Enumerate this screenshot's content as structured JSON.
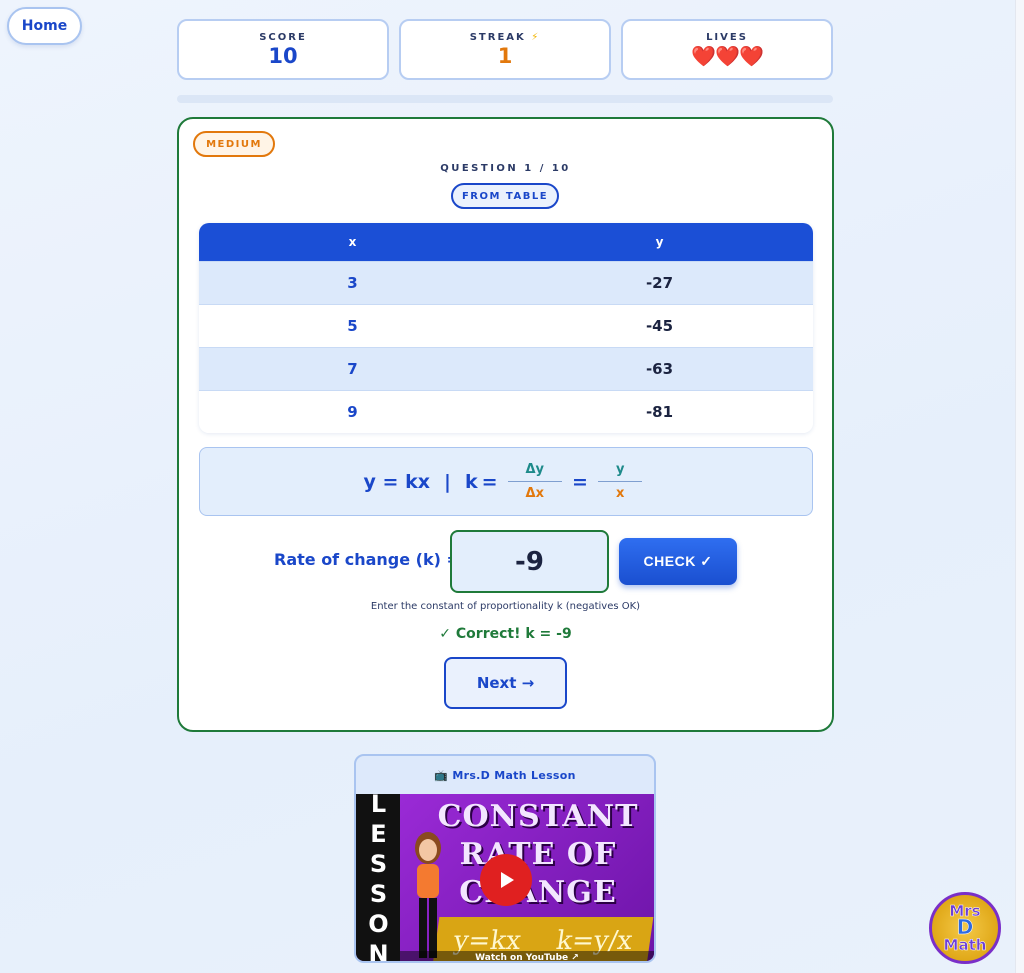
{
  "nav": {
    "home_label": "Home"
  },
  "stats": {
    "score": {
      "label": "SCORE",
      "value": "10"
    },
    "streak": {
      "label": "STREAK",
      "icon": "lightning-icon",
      "value": "1"
    },
    "lives": {
      "label": "LIVES",
      "hearts": "❤️❤️❤️",
      "count": 3
    }
  },
  "progress": {
    "fraction": 0.0
  },
  "colors": {
    "primary": "#1a47c9",
    "success": "#1f7a3a",
    "difficulty": "#e2780c",
    "table_header": "#1b4fd6"
  },
  "question": {
    "difficulty": "MEDIUM",
    "counter": "QUESTION 1 / 10",
    "type": "FROM TABLE",
    "table": {
      "headers": [
        "x",
        "y"
      ],
      "rows": [
        {
          "x": "3",
          "y": "-27"
        },
        {
          "x": "5",
          "y": "-45"
        },
        {
          "x": "7",
          "y": "-63"
        },
        {
          "x": "9",
          "y": "-81"
        }
      ]
    },
    "formula": {
      "lhs": "y = kx",
      "divider": "|",
      "k": "k",
      "eq": "=",
      "frac1_num": "Δy",
      "frac1_den": "Δx",
      "frac2_num": "y",
      "frac2_den": "x"
    },
    "answer_label": "Rate of change (k) =",
    "answer_value": "-9",
    "check_label": "CHECK ✓",
    "hint": "Enter the constant of proportionality k (negatives OK)",
    "feedback": "✓ Correct! k = -9",
    "next_label": "Next →"
  },
  "lesson": {
    "title": "📺 Mrs.D Math Lesson",
    "side_text": "LESSON",
    "video_title_line1": "CONSTANT",
    "video_title_line2": "RATE OF",
    "video_title_line3": "CHANGE",
    "board_left": "y=kx",
    "board_right": "k=y/x",
    "caption": "Watch on YouTube ↗"
  },
  "logo": {
    "line1": "Mrs",
    "line2": "D",
    "line3": "Math"
  }
}
